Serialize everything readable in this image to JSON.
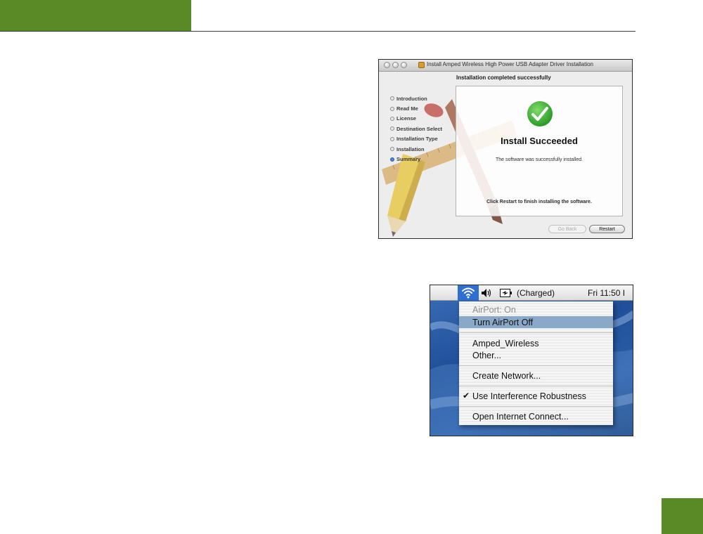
{
  "installer": {
    "window_title": "Install Amped Wireless High Power USB Adapter Driver Installation",
    "pane_heading": "Installation completed successfully",
    "steps": [
      {
        "label": "Introduction"
      },
      {
        "label": "Read Me"
      },
      {
        "label": "License"
      },
      {
        "label": "Destination Select"
      },
      {
        "label": "Installation Type"
      },
      {
        "label": "Installation"
      },
      {
        "label": "Summary"
      }
    ],
    "active_step": "Summary",
    "success_title": "Install Succeeded",
    "success_message": "The software was successfully installed.",
    "restart_note": "Click Restart to finish installing the software.",
    "buttons": {
      "back": "Go Back",
      "restart": "Restart"
    },
    "colors": {
      "check_green": "#33a833",
      "active_step_bullet": "#4a86d6"
    }
  },
  "airport_menu": {
    "menubar": {
      "battery_status": "(Charged)",
      "clock": "Fri 11:50 I"
    },
    "items": [
      {
        "label": "AirPort: On",
        "state": "disabled"
      },
      {
        "label": "Turn AirPort Off",
        "state": "highlighted"
      },
      {
        "label": "Amped_Wireless",
        "state": "normal"
      },
      {
        "label": "Other...",
        "state": "normal"
      },
      {
        "label": "Create Network...",
        "state": "normal"
      },
      {
        "label": "Use Interference Robustness",
        "state": "checked"
      },
      {
        "label": "Open Internet Connect...",
        "state": "normal"
      }
    ],
    "colors": {
      "wifi_highlight": "#2f6fd0",
      "row_highlight": "#8aa9c9"
    }
  },
  "page_colors": {
    "accent_green": "#5a8a26"
  }
}
